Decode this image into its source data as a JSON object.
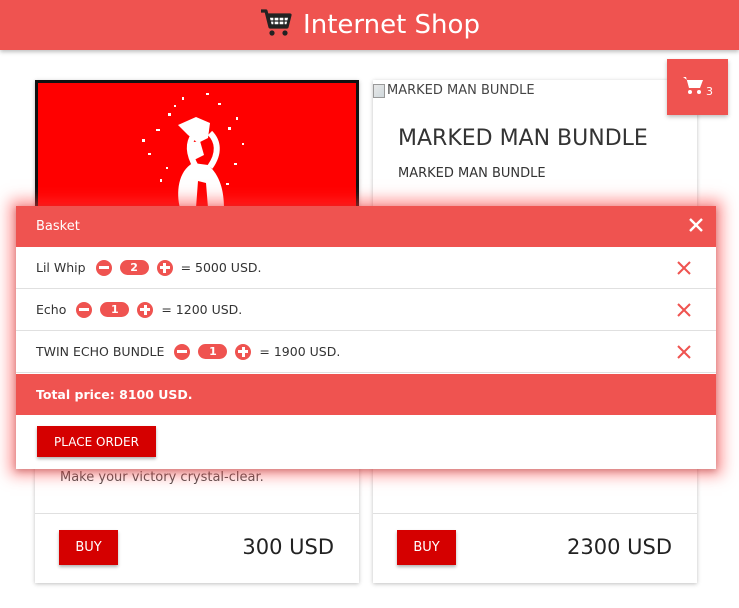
{
  "header": {
    "title": "Internet Shop",
    "logo_icon": "shopping-cart-icon"
  },
  "cart": {
    "count": "3",
    "icon": "shopping-cart-icon"
  },
  "colors": {
    "primary": "#ef5350",
    "button": "#d50000",
    "product_image_bg": "#ff0000"
  },
  "products": [
    {
      "description": "Make your victory crystal-clear.",
      "buy_label": "BUY",
      "price": "300 USD"
    },
    {
      "image_alt": "MARKED MAN BUNDLE",
      "title": "MARKED MAN BUNDLE",
      "subtitle": "MARKED MAN BUNDLE",
      "buy_label": "BUY",
      "price": "2300 USD"
    }
  ],
  "basket": {
    "title": "Basket",
    "items": [
      {
        "name": "Lil Whip",
        "qty": "2",
        "sum": "= 5000 USD."
      },
      {
        "name": "Echo",
        "qty": "1",
        "sum": "= 1200 USD."
      },
      {
        "name": "TWIN ECHO BUNDLE",
        "qty": "1",
        "sum": "= 1900 USD."
      }
    ],
    "total": "Total price: 8100 USD.",
    "place_order_label": "PLACE ORDER"
  }
}
